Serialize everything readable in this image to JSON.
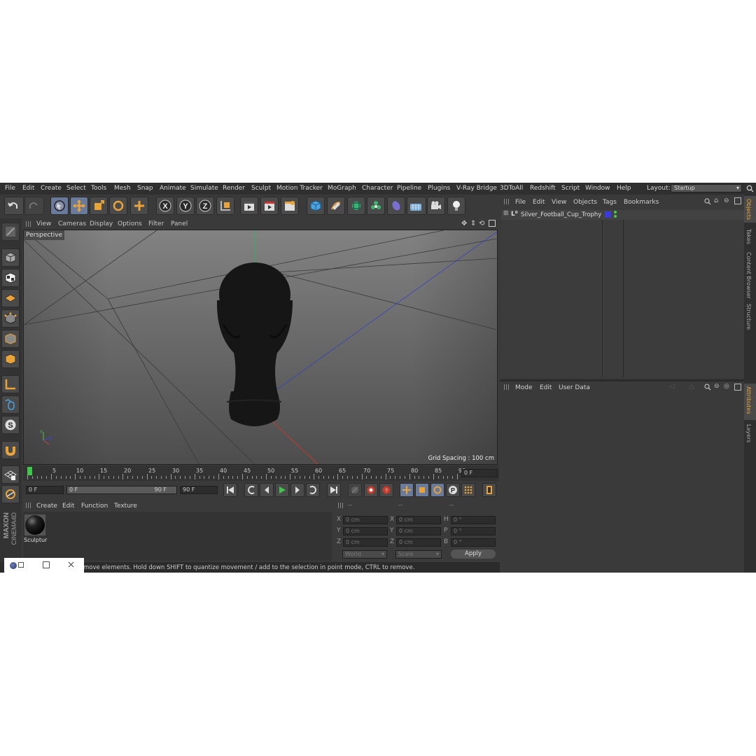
{
  "menu": [
    "File",
    "Edit",
    "Create",
    "Select",
    "Tools",
    "Mesh",
    "Snap",
    "Animate",
    "Simulate",
    "Render",
    "Sculpt",
    "Motion Tracker",
    "MoGraph",
    "Character",
    "Pipeline",
    "Plugins",
    "V-Ray Bridge",
    "3DToAll",
    "Redshift",
    "Script",
    "Window",
    "Help"
  ],
  "layout": {
    "label": "Layout:",
    "value": "Startup"
  },
  "viewport": {
    "menu": [
      "View",
      "Cameras",
      "Display",
      "Options",
      "Filter",
      "Panel"
    ],
    "camera_label": "Perspective",
    "grid_spacing": "Grid Spacing : 100 cm"
  },
  "timeline": {
    "ticks": [
      "0",
      "5",
      "10",
      "15",
      "20",
      "25",
      "30",
      "35",
      "40",
      "45",
      "50",
      "55",
      "60",
      "65",
      "70",
      "75",
      "80",
      "85",
      "90"
    ],
    "current_frame": "0 F"
  },
  "transport": {
    "start": "0 F",
    "range_start": "0 F",
    "range_end": "90 F",
    "end": "90 F"
  },
  "materials": {
    "menu": [
      "Create",
      "Edit",
      "Function",
      "Texture"
    ],
    "item_name": "Sculptur"
  },
  "coordinates": {
    "col_headers": [
      "--",
      "--",
      "--"
    ],
    "rows": [
      {
        "a": "X",
        "av": "0 cm",
        "b": "X",
        "bv": "0 cm",
        "c": "H",
        "cv": "0 °"
      },
      {
        "a": "Y",
        "av": "0 cm",
        "b": "Y",
        "bv": "0 cm",
        "c": "P",
        "cv": "0 °"
      },
      {
        "a": "Z",
        "av": "0 cm",
        "b": "Z",
        "bv": "0 cm",
        "c": "B",
        "cv": "0 °"
      }
    ],
    "world": "World",
    "scale": "Scale",
    "apply": "Apply"
  },
  "status": "move elements. Hold down SHIFT to quantize movement / add to the selection in point mode, CTRL to remove.",
  "objects": {
    "menu": [
      "File",
      "Edit",
      "View",
      "Objects",
      "Tags",
      "Bookmarks"
    ],
    "item": "Silver_Football_Cup_Trophy"
  },
  "attributes": {
    "menu": [
      "Mode",
      "Edit",
      "User Data"
    ]
  },
  "side_tabs": [
    "Objects",
    "Takes",
    "Content Browser",
    "Structure",
    "Attributes",
    "Layers"
  ],
  "brand": {
    "line1": "MAXON",
    "line2": "CINEMA4D"
  },
  "colors": {
    "accent": "#e8a33a",
    "bg": "#3a3a3a",
    "selection": "#6a7a9a"
  }
}
